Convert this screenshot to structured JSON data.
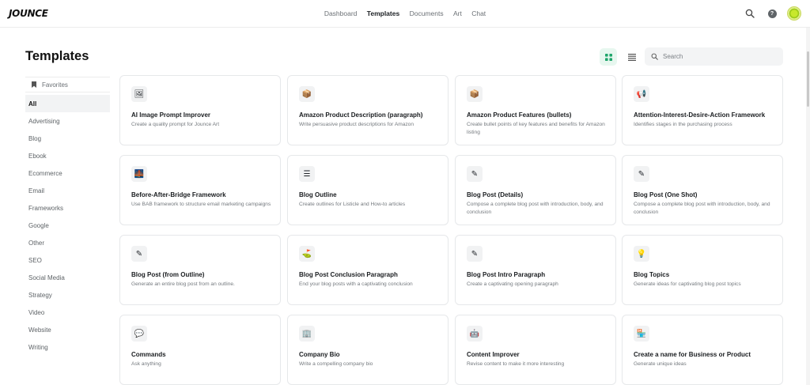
{
  "app": {
    "logo": "JOUNCE"
  },
  "nav": {
    "items": [
      {
        "label": "Dashboard",
        "active": false
      },
      {
        "label": "Templates",
        "active": true
      },
      {
        "label": "Documents",
        "active": false
      },
      {
        "label": "Art",
        "active": false
      },
      {
        "label": "Chat",
        "active": false
      }
    ]
  },
  "page": {
    "title": "Templates"
  },
  "toolbar": {
    "search_placeholder": "Search",
    "active_view": "grid"
  },
  "sidebar": {
    "favorites_label": "Favorites",
    "categories": [
      {
        "label": "All",
        "active": true
      },
      {
        "label": "Advertising"
      },
      {
        "label": "Blog"
      },
      {
        "label": "Ebook"
      },
      {
        "label": "Ecommerce"
      },
      {
        "label": "Email"
      },
      {
        "label": "Frameworks"
      },
      {
        "label": "Google"
      },
      {
        "label": "Other"
      },
      {
        "label": "SEO"
      },
      {
        "label": "Social Media"
      },
      {
        "label": "Strategy"
      },
      {
        "label": "Video"
      },
      {
        "label": "Website"
      },
      {
        "label": "Writing"
      }
    ]
  },
  "templates": [
    {
      "title": "AI Image Prompt Improver",
      "description": "Create a quality prompt for Jounce Art",
      "icon": "image-icon",
      "glyph": "🖼"
    },
    {
      "title": "Amazon Product Description (paragraph)",
      "description": "Write persuasive product descriptions for Amazon",
      "icon": "amazon-icon",
      "glyph": "📦"
    },
    {
      "title": "Amazon Product Features (bullets)",
      "description": "Create bullet points of key features and benefits for Amazon listing",
      "icon": "amazon-icon",
      "glyph": "📦"
    },
    {
      "title": "Attention-Interest-Desire-Action Framework",
      "description": "Identifies stages in the purchasing process",
      "icon": "megaphone-icon",
      "glyph": "📢"
    },
    {
      "title": "Before-After-Bridge Framework",
      "description": "Use BAB framework to structure email marketing campaigns",
      "icon": "bridge-icon",
      "glyph": "🌉"
    },
    {
      "title": "Blog Outline",
      "description": "Create outlines for Listicle and How-to articles",
      "icon": "list-icon",
      "glyph": "☰"
    },
    {
      "title": "Blog Post (Details)",
      "description": "Compose a complete blog post with introduction, body, and conclusion",
      "icon": "edit-icon",
      "glyph": "✎"
    },
    {
      "title": "Blog Post (One Shot)",
      "description": "Compose a complete blog post with introduction, body, and conclusion",
      "icon": "edit-icon",
      "glyph": "✎"
    },
    {
      "title": "Blog Post (from Outline)",
      "description": "Generate an entire blog post from an outline.",
      "icon": "edit-icon",
      "glyph": "✎"
    },
    {
      "title": "Blog Post Conclusion Paragraph",
      "description": "End your blog posts with a captivating conclusion",
      "icon": "flag-icon",
      "glyph": "⛳"
    },
    {
      "title": "Blog Post Intro Paragraph",
      "description": "Create a captivating opening paragraph",
      "icon": "edit-icon",
      "glyph": "✎"
    },
    {
      "title": "Blog Topics",
      "description": "Generate ideas for captivating blog post topics",
      "icon": "lightbulb-icon",
      "glyph": "💡"
    },
    {
      "title": "Commands",
      "description": "Ask anything",
      "icon": "chat-bubble-icon",
      "glyph": "💬"
    },
    {
      "title": "Company Bio",
      "description": "Write a compelling company bio",
      "icon": "building-icon",
      "glyph": "🏢"
    },
    {
      "title": "Content Improver",
      "description": "Revise content to make it more interesting",
      "icon": "robot-icon",
      "glyph": "🤖"
    },
    {
      "title": "Create a name for Business or Product",
      "description": "Generate unique ideas",
      "icon": "store-icon",
      "glyph": "🏪"
    }
  ]
}
